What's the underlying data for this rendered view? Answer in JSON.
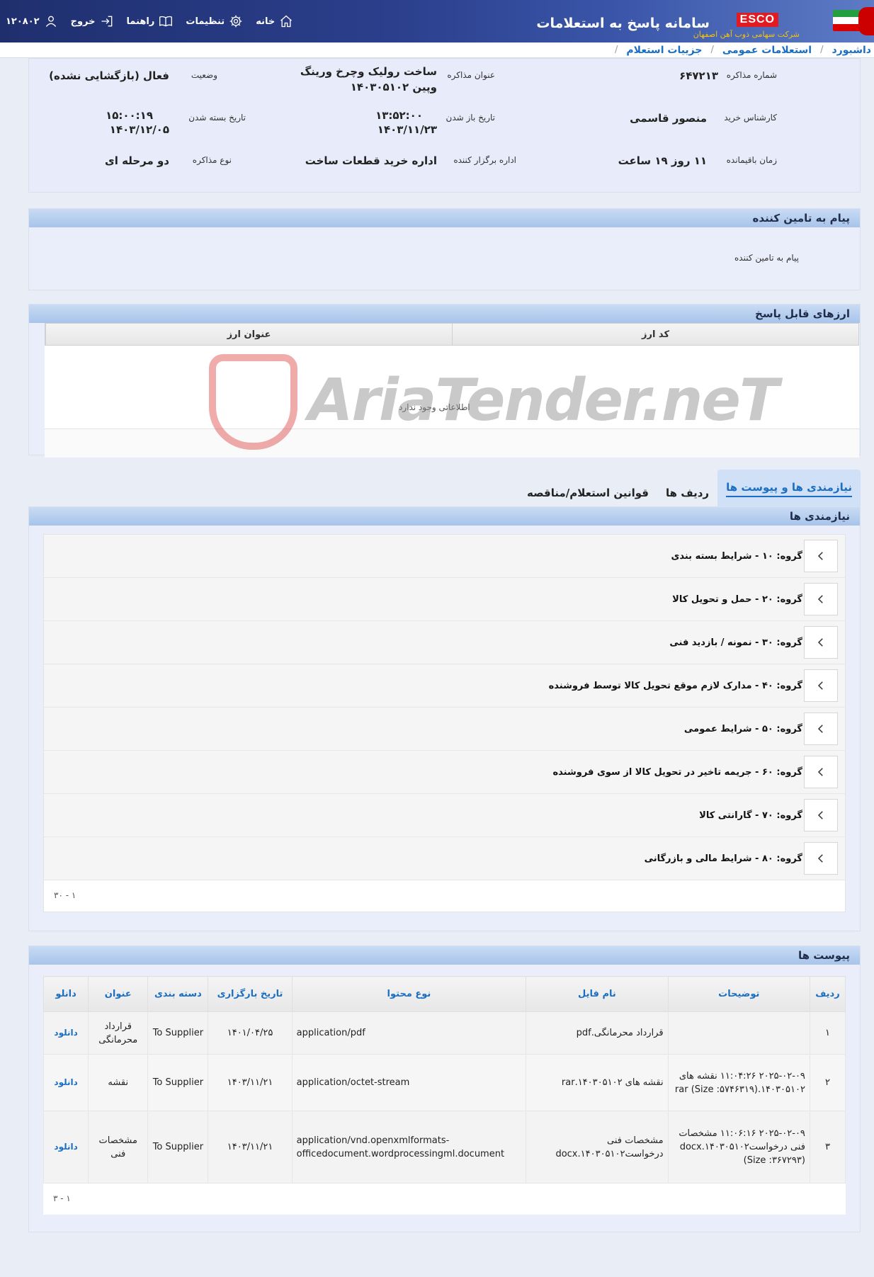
{
  "header": {
    "app_title": "سامانه پاسخ به استعلامات",
    "esco": "ESCO",
    "esco_sub": "شرکت سهامی ذوب آهن اصفهان",
    "nav": {
      "home": "خانه",
      "settings": "تنظیمات",
      "guides": "راهنما",
      "logout": "خروج",
      "user_id": "۱۲۰۸۰۲"
    }
  },
  "breadcrumb": [
    "داشبورد",
    "استعلامات عمومی",
    "جزییات استعلام"
  ],
  "info": {
    "number_label": "شماره مذاکره",
    "number": "۶۴۷۲۱۳",
    "title_label": "عنوان مذاکره",
    "title_line1": "ساخت رولیک وچرخ ورینگ",
    "title_line2": "وپین ۱۴۰۳۰۵۱۰۲",
    "status_label": "وضعیت",
    "status": "فعال (بازگشایی نشده)",
    "expert_label": "کارشناس خرید",
    "expert": "منصور قاسمی",
    "open_date_label": "تاریخ باز شدن",
    "open_time": "۱۳:۵۲:۰۰",
    "open_date": "۱۴۰۳/۱۱/۲۳",
    "close_date_label": "تاریخ بسته شدن",
    "close_time": "۱۵:۰۰:۱۹",
    "close_date": "۱۴۰۳/۱۲/۰۵",
    "remaining_label": "زمان باقیمانده",
    "remaining": "۱۱ روز ۱۹ ساعت",
    "organizer_label": "اداره برگزار کننده",
    "organizer": "اداره خرید قطعات ساخت",
    "type_label": "نوع مذاکره",
    "type": "دو مرحله ای"
  },
  "supplier_message": {
    "title": "پیام به تامین کننده",
    "body": "پیام به تامین کننده"
  },
  "currencies": {
    "title": "ارزهای قابل پاسخ",
    "col_code": "کد ارز",
    "col_title": "عنوان ارز",
    "empty": "اطلاعاتی وجود ندارد"
  },
  "watermark": "AriaTender.neT",
  "tabs": [
    "نیازمندی ها و پیوست ها",
    "ردیف ها",
    "قوانین استعلام/مناقصه"
  ],
  "requirements": {
    "title": "نیازمندی ها",
    "groups": [
      "گروه: ۱۰ - شرایط بسته بندی",
      "گروه: ۲۰ - حمل و تحویل کالا",
      "گروه: ۳۰ - نمونه / بازدید فنی",
      "گروه: ۴۰ - مدارک لازم موقع تحویل کالا توسط فروشنده",
      "گروه: ۵۰ - شرایط عمومی",
      "گروه: ۶۰ - جریمه تاخیر در تحویل کالا از سوی فروشنده",
      "گروه: ۷۰ - گارانتی کالا",
      "گروه: ۸۰ - شرایط مالی و بازرگانی"
    ],
    "pager": "۱ - ۳۰"
  },
  "attachments": {
    "title": "پیوست ها",
    "columns": [
      "ردیف",
      "توضیحات",
      "نام فایل",
      "نوع محتوا",
      "تاریخ بارگزاری",
      "دسته بندی",
      "عنوان",
      "دانلو"
    ],
    "rows": [
      {
        "idx": "۱",
        "desc": "",
        "file": "قرارداد محرمانگی.pdf",
        "type": "application/pdf",
        "date": "۱۴۰۱/۰۴/۲۵",
        "cat": "To Supplier",
        "title": "قرارداد محرمانگی",
        "dl": "دانلود"
      },
      {
        "idx": "۲",
        "desc": "۲۰۲۵-۰۲-۰۹ ۱۱:۰۴:۲۶ نقشه های ۱۴۰۳۰۵۱۰۲.rar (Size :۵۷۴۶۳۱۹)",
        "file": "نقشه های ۱۴۰۳۰۵۱۰۲.rar",
        "type": "application/octet-stream",
        "date": "۱۴۰۳/۱۱/۲۱",
        "cat": "To Supplier",
        "title": "نقشه",
        "dl": "دانلود"
      },
      {
        "idx": "۳",
        "desc": "۲۰۲۵-۰۲-۰۹ ۱۱:۰۶:۱۶ مشخصات فنی درخواست۱۴۰۳۰۵۱۰۲.docx (Size :۳۶۷۲۹۳)",
        "file": "مشخصات فنی درخواست۱۴۰۳۰۵۱۰۲.docx",
        "type": "application/vnd.openxmlformats-officedocument.wordprocessingml.document",
        "date": "۱۴۰۳/۱۱/۲۱",
        "cat": "To Supplier",
        "title": "مشخصات فنی",
        "dl": "دانلود"
      }
    ],
    "pager": "۱ - ۳"
  }
}
